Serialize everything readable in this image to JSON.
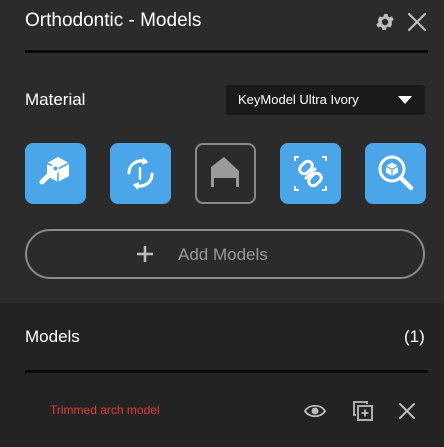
{
  "header": {
    "title": "Orthodontic - Models"
  },
  "material": {
    "label": "Material",
    "selected": "KeyModel Ultra Ivory"
  },
  "tools": [
    {
      "icon": "cube-wrench-icon"
    },
    {
      "icon": "rotate-arrows-icon"
    },
    {
      "icon": "model-base-icon"
    },
    {
      "icon": "link-chain-icon"
    },
    {
      "icon": "cube-search-icon"
    }
  ],
  "add_models": {
    "label": "Add Models"
  },
  "models": {
    "title": "Models",
    "count": "(1)",
    "items": [
      {
        "name": "Trimmed arch model"
      }
    ]
  },
  "colors": {
    "accent": "#4aa6e8",
    "background": "#2b2b2b",
    "error_text": "#e33b3b"
  }
}
